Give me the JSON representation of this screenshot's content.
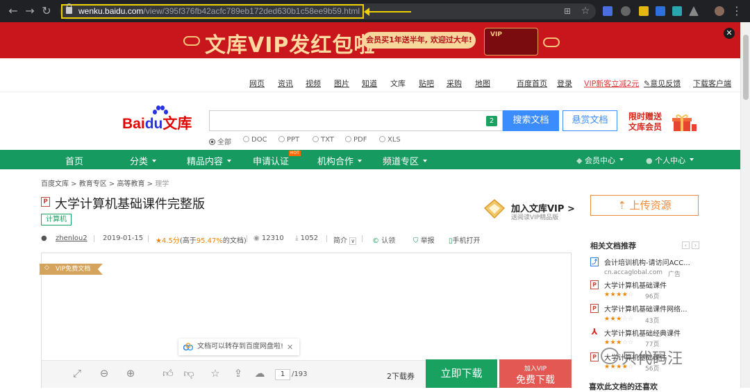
{
  "browser": {
    "url_host": "wenku.baidu.com",
    "url_path": "/view/395f376fb42acfc789eb172ded630b1c58ee9b59.html"
  },
  "banner": {
    "title": "文库VIP发红包啦",
    "pill": "会员买1年送半年, 欢迎过大年!",
    "card": "VIP"
  },
  "top_links": [
    "网页",
    "资讯",
    "视频",
    "图片",
    "知道",
    "文库",
    "贴吧",
    "采购",
    "地图",
    "百度首页",
    "登录",
    "VIP新客立减2元",
    "意见反馈",
    "下载客户端"
  ],
  "logo": {
    "bai": "Bai",
    "du": "du",
    "wenku": "文库"
  },
  "search": {
    "count_badge": "2",
    "search_button": "搜索文档",
    "browse_button": "悬赏文档",
    "promo_line1": "限时赠送",
    "promo_line2": "文库会员",
    "filters": [
      "全部",
      "DOC",
      "PPT",
      "TXT",
      "PDF",
      "XLS"
    ]
  },
  "nav": {
    "items": [
      "首页",
      "分类",
      "精品内容",
      "申请认证",
      "机构合作",
      "频道专区"
    ],
    "hot": "HOT",
    "member_center": "会员中心",
    "personal_center": "个人中心"
  },
  "breadcrumb": [
    "百度文库",
    "教育专区",
    "高等教育",
    "理学"
  ],
  "doc": {
    "type_icon": "P",
    "title": "大学计算机基础课件完整版",
    "tag": "计算机",
    "author": "zhenlou2",
    "date": "2019-01-15",
    "rating": "4.5分",
    "rating_note_pre": "(高于",
    "rating_pct": "95.47%",
    "rating_note_post": "的文档)",
    "views": "12310",
    "downloads": "1052",
    "intro": "简介",
    "claim": "认领",
    "report": "举报",
    "mobile": "手机打开"
  },
  "vip": {
    "join": "加入文库VIP >",
    "sub": "送阅读VIP精品版"
  },
  "viewer": {
    "vip_flag": "VIP免费文档",
    "toast": "文档可以转存到百度网盘啦!",
    "page_current": "1",
    "page_total": "/193",
    "coupons": "2下载券",
    "download": "立即下载",
    "vip_dl_top": "加入VIP",
    "vip_dl_bottom": "免费下载"
  },
  "sidebar": {
    "upload": "上传资源",
    "related_title": "相关文档推荐",
    "ad": {
      "title": "会计培训机构-请访问ACC...",
      "url": "cn.accaglobal.com",
      "tag": "广告"
    },
    "items": [
      {
        "icon": "P",
        "title": "大学计算机基础课件",
        "stars": 4,
        "pages": "96页"
      },
      {
        "icon": "P",
        "title": "大学计算机基础课件网络...",
        "stars": 3,
        "pages": "43页"
      },
      {
        "icon": "pdf",
        "title": "大学计算机基础经典课件",
        "stars": 3,
        "pages": "77页"
      },
      {
        "icon": "P",
        "title": "大学计算机基础课件",
        "stars": 4,
        "pages": "56页"
      }
    ],
    "more_title": "喜欢此文档的还喜欢"
  },
  "watermark": "只代码汪",
  "colors": {
    "green": "#169a60",
    "red": "#c9161d",
    "blue": "#3b8cff",
    "orange": "#f08c3d"
  }
}
